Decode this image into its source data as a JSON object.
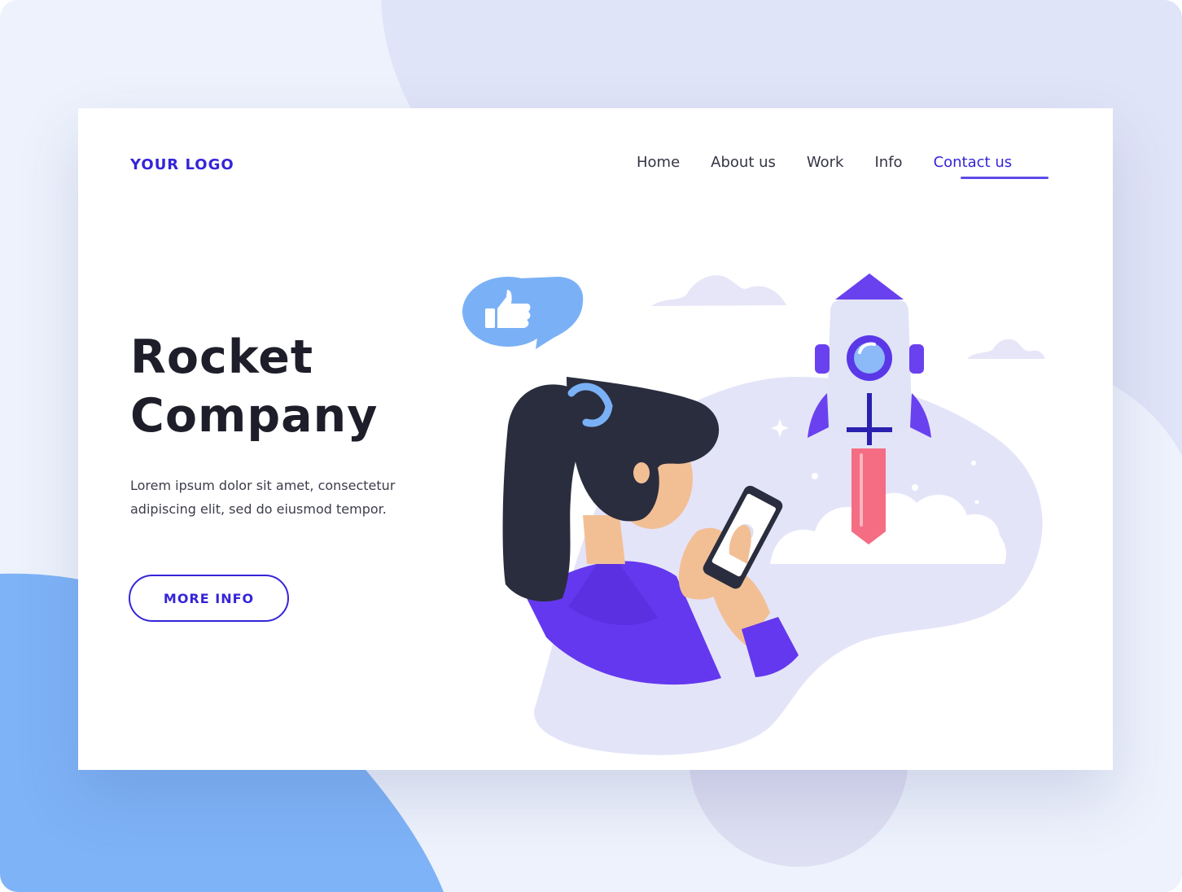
{
  "page": {
    "logo": "YOUR LOGO",
    "colors": {
      "accent": "#3524d8",
      "violet": "#6438ee",
      "heading": "#1d1e29",
      "body_text": "#3c3d4a",
      "soft_lilac": "#e3e3f8",
      "bright_blue": "#7ab1f6",
      "rocket_flame": "#f46d83",
      "skin": "#f2bf95",
      "hair": "#2a2d3d"
    }
  },
  "nav": {
    "items": [
      {
        "label": "Home",
        "active": false
      },
      {
        "label": "About us",
        "active": false
      },
      {
        "label": "Work",
        "active": false
      },
      {
        "label": "Info",
        "active": false
      },
      {
        "label": "Contact us",
        "active": true
      }
    ]
  },
  "hero": {
    "title_line1": "Rocket",
    "title_line2": "Company",
    "text_line1": "Lorem ipsum dolor sit amet, consectetur",
    "text_line2": "adipiscing elit, sed do eiusmod tempor.",
    "button_label": "MORE INFO"
  },
  "illustration": {
    "icons": [
      "thumbs-up-icon",
      "rocket-icon",
      "smartphone-icon",
      "cloud-icon",
      "sparkle-icon"
    ]
  }
}
